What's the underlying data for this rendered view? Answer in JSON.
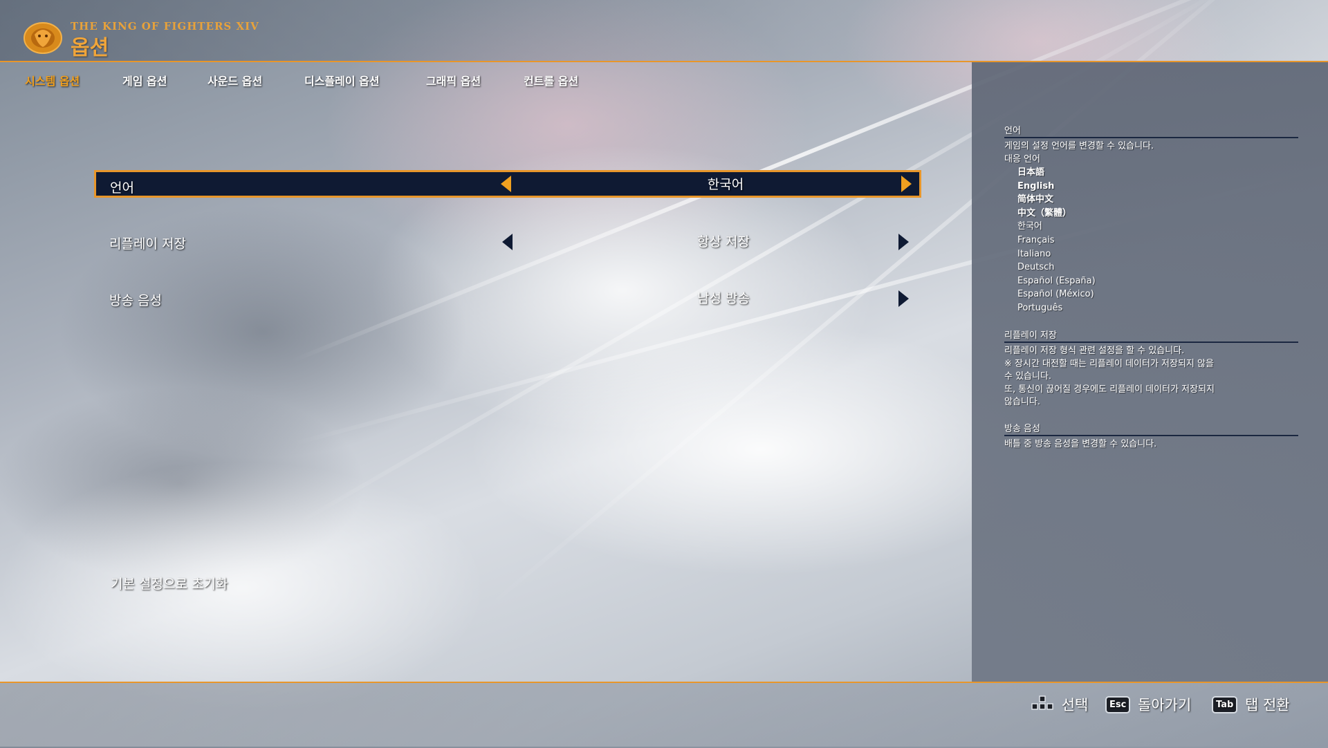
{
  "header": {
    "game_title": "THE KING OF FIGHTERS XIV",
    "page_title": "옵션"
  },
  "tabs": [
    {
      "label": "시스템 옵션",
      "active": true
    },
    {
      "label": "게임 옵션",
      "active": false
    },
    {
      "label": "사운드 옵션",
      "active": false
    },
    {
      "label": "디스플레이 옵션",
      "active": false
    },
    {
      "label": "그래픽 옵션",
      "active": false
    },
    {
      "label": "컨트롤 옵션",
      "active": false
    }
  ],
  "options": [
    {
      "label": "언어",
      "value": "한국어",
      "selected": true
    },
    {
      "label": "리플레이 저장",
      "value": "항상 저장",
      "selected": false
    },
    {
      "label": "방송 음성",
      "value": "남성 방송",
      "selected": false
    }
  ],
  "reset_label": "기본 설정으로 초기화",
  "info": {
    "language": {
      "heading": "언어",
      "description": "게임의 설정 언어를 변경할 수 있습니다.",
      "supported_label": "대응 언어",
      "languages": [
        "日本語",
        "English",
        "简体中文",
        "中文（繁體）",
        "한국어",
        "Français",
        "Italiano",
        "Deutsch",
        "Español (España)",
        "Español (México)",
        "Português"
      ]
    },
    "replay": {
      "heading": "리플레이 저장",
      "lines": [
        "리플레이 저장 형식 관련 설정을 할 수 있습니다.",
        "※ 장시간 대전할 때는 리플레이 데이터가 저장되지 않을",
        "수 있습니다.",
        "또, 통신이 끊어질 경우에도 리플레이 데이터가 저장되지",
        "않습니다."
      ]
    },
    "announcer": {
      "heading": "방송 음성",
      "description": "배틀 중 방송 음성을 변경할 수 있습니다."
    }
  },
  "footer": {
    "select_label": "선택",
    "back_key": "Esc",
    "back_label": "돌아가기",
    "tab_key": "Tab",
    "tab_label": "탭 전환"
  },
  "colors": {
    "accent": "#e8962a",
    "selected_row_bg": "#0f1a33",
    "active_tab": "#f0a020"
  }
}
